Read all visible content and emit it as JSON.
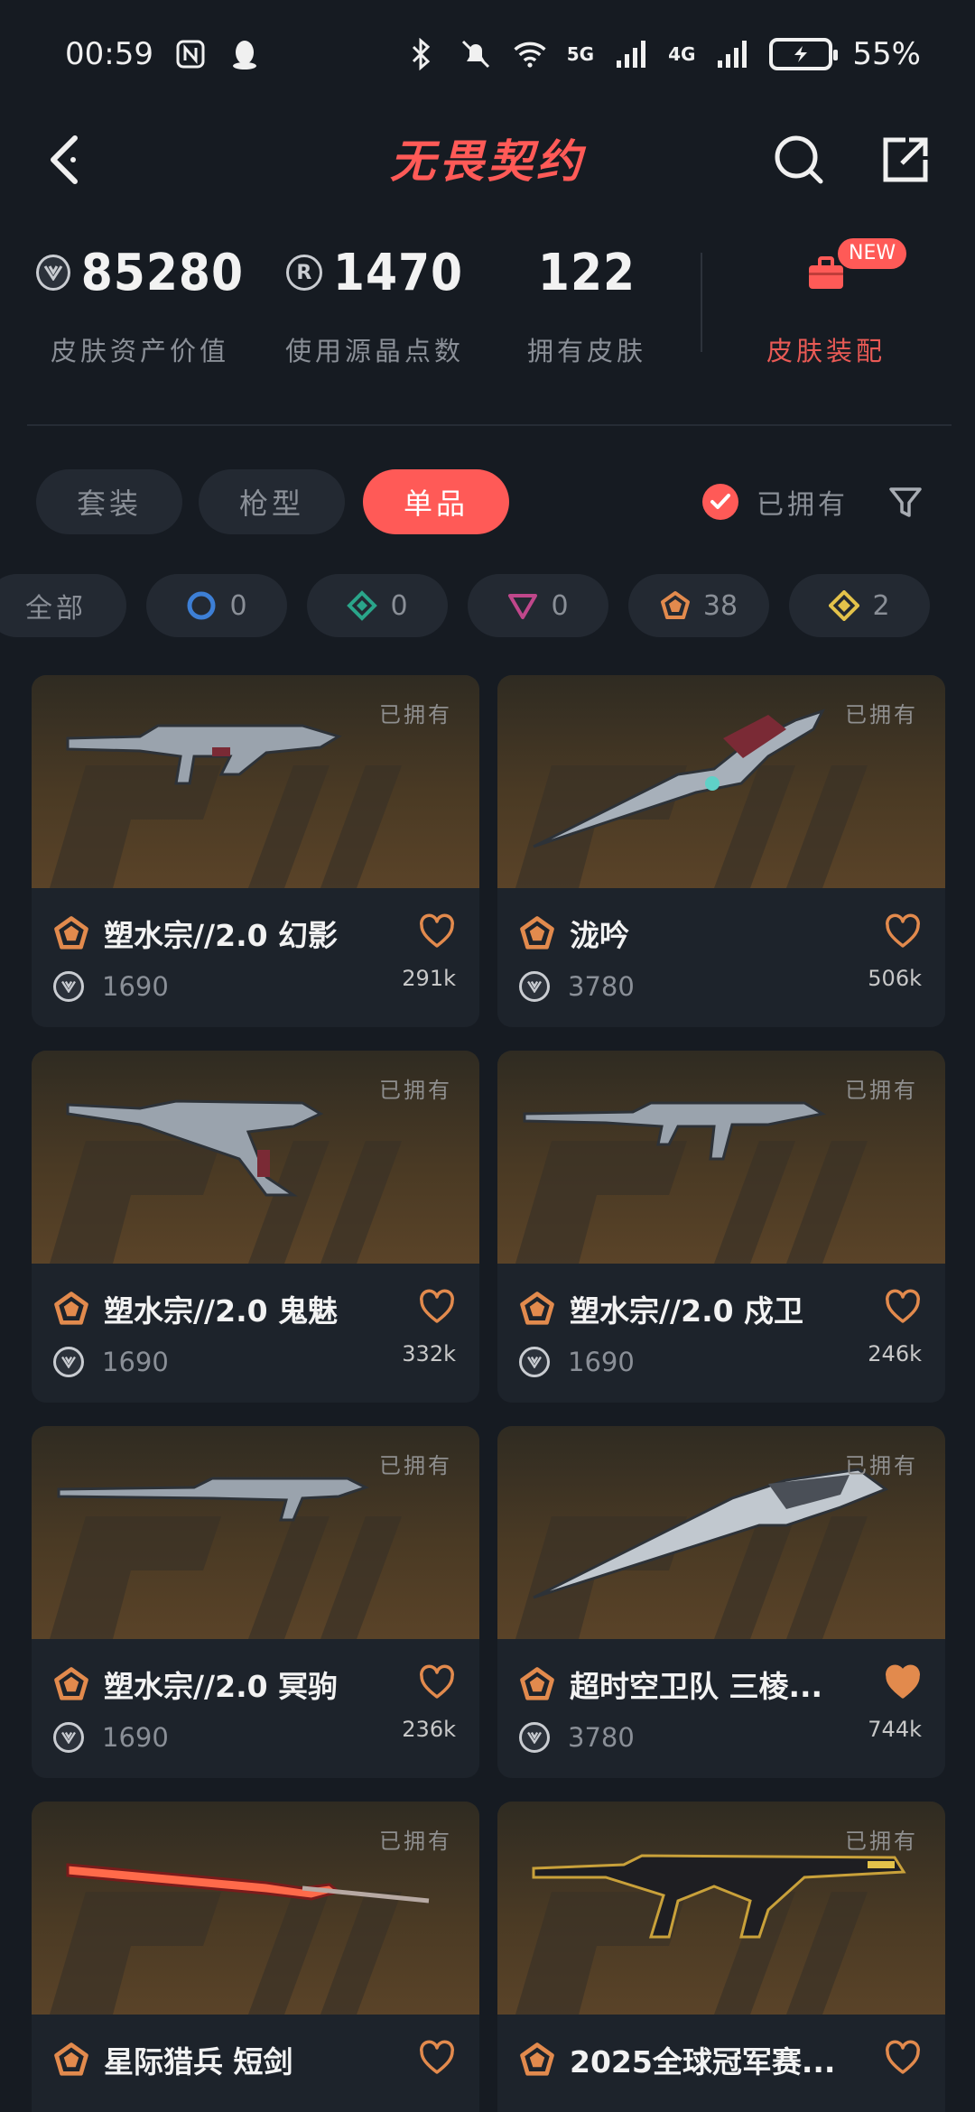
{
  "status": {
    "time": "00:59",
    "battery": "55%",
    "net1": "5G",
    "net2": "4G"
  },
  "nav": {
    "title": "无畏契约"
  },
  "stats": {
    "asset_value": "85280",
    "asset_label": "皮肤资产价值",
    "rp_value": "1470",
    "rp_label": "使用源晶点数",
    "owned_value": "122",
    "owned_label": "拥有皮肤",
    "loadout_label": "皮肤装配",
    "new_badge": "NEW"
  },
  "filters": {
    "tabs": [
      "套装",
      "枪型",
      "单品"
    ],
    "active_index": 2,
    "owned_label": "已拥有"
  },
  "tiers": [
    {
      "label": "全部",
      "count": ""
    },
    {
      "icon": "select-tier-icon",
      "count": "0",
      "color": "#3d7fd6"
    },
    {
      "icon": "deluxe-tier-icon",
      "count": "0",
      "color": "#2aa58a"
    },
    {
      "icon": "premium-tier-icon",
      "count": "0",
      "color": "#c0478b"
    },
    {
      "icon": "exclusive-tier-icon",
      "count": "38",
      "color": "#e28a4d"
    },
    {
      "icon": "ultra-tier-icon",
      "count": "2",
      "color": "#e3c24a"
    }
  ],
  "skins": [
    {
      "name": "塑水宗//2.0 幻影",
      "price": "1690",
      "likes": "291k",
      "owned": "已拥有",
      "favorited": false
    },
    {
      "name": "泷吟",
      "price": "3780",
      "likes": "506k",
      "owned": "已拥有",
      "favorited": false
    },
    {
      "name": "塑水宗//2.0 鬼魅",
      "price": "1690",
      "likes": "332k",
      "owned": "已拥有",
      "favorited": false
    },
    {
      "name": "塑水宗//2.0 戍卫",
      "price": "1690",
      "likes": "246k",
      "owned": "已拥有",
      "favorited": false
    },
    {
      "name": "塑水宗//2.0 冥驹",
      "price": "1690",
      "likes": "236k",
      "owned": "已拥有",
      "favorited": false
    },
    {
      "name": "超时空卫队 三棱...",
      "price": "3780",
      "likes": "744k",
      "owned": "已拥有",
      "favorited": true
    },
    {
      "name": "星际猎兵 短剑",
      "price": "",
      "likes": "",
      "owned": "已拥有",
      "favorited": false
    },
    {
      "name": "2025全球冠军赛...",
      "price": "",
      "likes": "",
      "owned": "已拥有",
      "favorited": false
    }
  ],
  "colors": {
    "accent": "#ff5a57",
    "bg": "#161b22",
    "card": "#1d232b",
    "tier_exclusive": "#e28a4d"
  }
}
